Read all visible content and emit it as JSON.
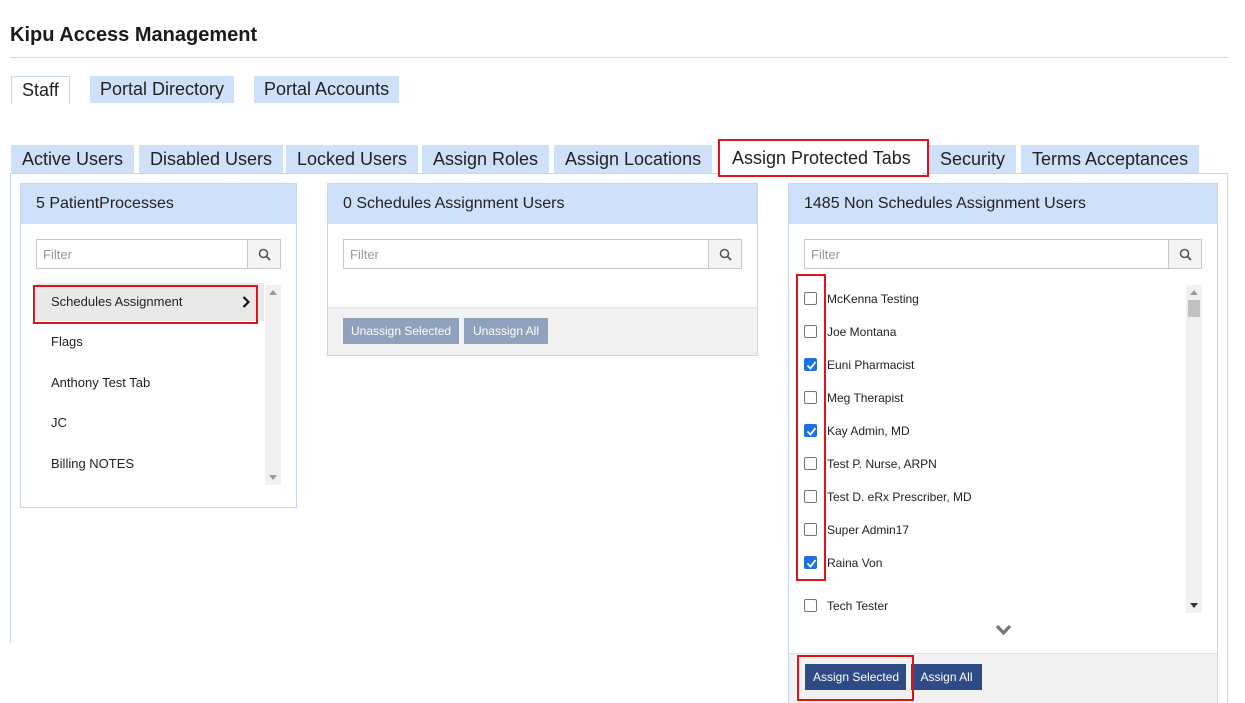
{
  "app": {
    "title": "Kipu Access Management"
  },
  "top_tabs": [
    "Staff",
    "Portal Directory",
    "Portal Accounts"
  ],
  "sub_tabs": [
    "Active Users",
    "Disabled Users",
    "Locked Users",
    "Assign Roles",
    "Assign Locations",
    "Assign Protected Tabs",
    "Security",
    "Terms Acceptances"
  ],
  "processes_panel": {
    "title": "5 PatientProcesses",
    "filter_placeholder": "Filter",
    "items": [
      "Schedules Assignment",
      "Flags",
      "Anthony Test Tab",
      "JC",
      "Billing NOTES"
    ],
    "selected_index": 0
  },
  "assigned_panel": {
    "title": "0 Schedules Assignment Users",
    "filter_placeholder": "Filter",
    "unassign_selected_label": "Unassign Selected",
    "unassign_all_label": "Unassign All"
  },
  "unassigned_panel": {
    "title": "1485 Non Schedules Assignment Users",
    "filter_placeholder": "Filter",
    "users": [
      {
        "name": "McKenna Testing",
        "checked": false
      },
      {
        "name": "Joe Montana",
        "checked": false
      },
      {
        "name": "Euni Pharmacist",
        "checked": true
      },
      {
        "name": "Meg Therapist",
        "checked": false
      },
      {
        "name": "Kay Admin, MD",
        "checked": true
      },
      {
        "name": "Test P. Nurse, ARPN",
        "checked": false
      },
      {
        "name": "Test D. eRx Prescriber, MD",
        "checked": false
      },
      {
        "name": "Super Admin17",
        "checked": false
      },
      {
        "name": "Raina Von",
        "checked": true
      },
      {
        "name": "Tech Tester",
        "checked": false
      }
    ],
    "assign_selected_label": "Assign Selected",
    "assign_all_label": "Assign All"
  },
  "colors": {
    "tab_bg": "#cfe0fb",
    "highlight_red": "#e0121b",
    "primary_button": "#2f4b85",
    "disabled_button": "#8fa1bd",
    "checkbox_checked": "#1f70e0"
  },
  "icons": {
    "filter_search": "magnifier-icon",
    "selected_item": "chevron-right-icon",
    "load_more": "chevron-down-icon"
  }
}
